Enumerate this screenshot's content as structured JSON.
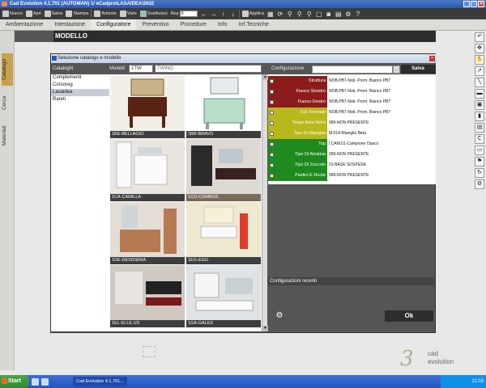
{
  "window": {
    "title": "Cad Evolution 4.1.701 (AUTOMAN) 1/ eCadpro\\LASAIDEA\\2632"
  },
  "toolbar": {
    "nuovo": "Nuovo",
    "apri": "Apri",
    "salva": "Salva",
    "stampa": "Stampa",
    "articolo": "Articolo",
    "viste": "Viste",
    "sostituisci": "Sostituisci",
    "rep_value": "0",
    "rep_label": "Rep",
    "applica": "Applica"
  },
  "menu": {
    "items": [
      "Ambientazione",
      "Intestazione",
      "Configuratore",
      "Preventivo",
      "Procedure",
      "Info",
      "Inf.Tecniche"
    ],
    "active": "Configuratore"
  },
  "sidetabs": [
    "Catalogo",
    "Cerca",
    "Materiali"
  ],
  "panel": {
    "title": "MODELLO"
  },
  "dialog": {
    "title": "Selezione catalogo e modello",
    "cataloghi_label": "Cataloghi",
    "modelli_label": "Modelli",
    "model_code": "1TW",
    "model_name": "TWING",
    "configurazione_label": "Configurazione",
    "salva_label": "Salva",
    "dots_label": "...",
    "catalogs": [
      "Complementi",
      "Corsoreg",
      "Lasaidea",
      "Rareti"
    ],
    "selected_catalog": "Lasaidea",
    "models": [
      "1BE-BELLAGIO",
      "1BR-BRAVO",
      "1CA-CAMILLA",
      "1CO-COMBOS",
      "1DE-DESIDERIA",
      "1EG-EGO",
      "1EL-ELLE US",
      "1GA-GALEX"
    ],
    "config_rows": [
      {
        "label": "Struttura",
        "value": "NOB.PB7-Nob. Prom. Bianco PB7",
        "color": "#8c1c1c"
      },
      {
        "label": "Fianco Sinistro",
        "value": "NOB.PB7-Nob. Prom. Bianco PB7",
        "color": "#8c1c1c"
      },
      {
        "label": "Fianco Destro",
        "value": "NOB.PB7-Nob. Prom. Bianco PB7",
        "color": "#8c1c1c"
      },
      {
        "label": "Col. Frontale",
        "value": "NOB.PB7-Nob. Prom. Bianco PB7",
        "color": "#b8b81c"
      },
      {
        "label": "Telaio Anta Vetro",
        "value": "999-NON PRESENTE",
        "color": "#b8b81c"
      },
      {
        "label": "Tipo Di Maniglia",
        "value": "M.014-Maniglia Beta",
        "color": "#b8b81c"
      },
      {
        "label": "Top",
        "value": "I.CAM.01-Campione Opaco",
        "color": "#1f8a1f"
      },
      {
        "label": "Tipo Di Alzatina",
        "value": "999-NON PRESENTE",
        "color": "#1f8a1f"
      },
      {
        "label": "Tipo Di Zoccolo",
        "value": "01-BASE SOSPESA",
        "color": "#1f8a1f"
      },
      {
        "label": "Piedini E Ruote",
        "value": "999-NON PRESENTE",
        "color": "#1f8a1f"
      }
    ],
    "recent_label": "Configurazioni recenti",
    "ok_label": "Ok"
  },
  "logo": {
    "text1": "cad",
    "text2": "evolution",
    "mark": "3"
  },
  "taskbar": {
    "start": "Start",
    "task": "Cad Evolution 4.1.701...",
    "clock": "11:03"
  }
}
